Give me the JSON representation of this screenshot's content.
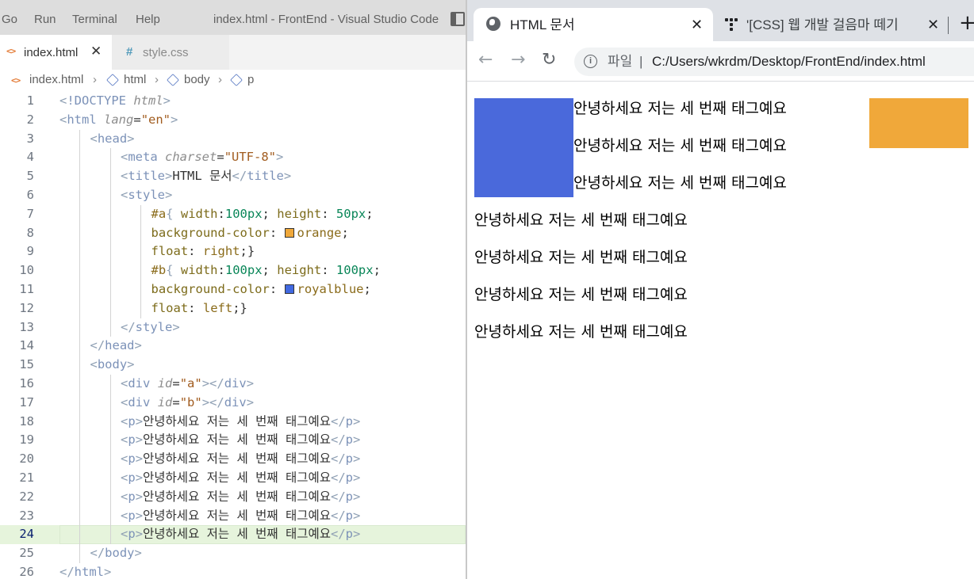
{
  "vscode": {
    "menu": [
      "Go",
      "Run",
      "Terminal",
      "Help"
    ],
    "window_title": "index.html - FrontEnd - Visual Studio Code",
    "tabs": [
      {
        "label": "index.html",
        "active": true,
        "icon": "html-icon"
      },
      {
        "label": "style.css",
        "active": false,
        "icon": "css-hash-icon"
      }
    ],
    "breadcrumb": [
      "index.html",
      "html",
      "body",
      "p"
    ],
    "active_line": 24,
    "colors": {
      "orange": "#f0a83a",
      "royalblue": "#4169e1"
    },
    "lines": [
      "<!DOCTYPE html>",
      "<html lang=\"en\">",
      "<head>",
      "<meta charset=\"UTF-8\">",
      "<title>HTML 문서</title>",
      "<style>",
      "#a{ width:100px; height: 50px;",
      "background-color: orange;",
      "float: right;}",
      "#b{ width:100px; height: 100px;",
      "background-color: royalblue;",
      "float: left;}",
      "</style>",
      "</head>",
      "<body>",
      "<div id=\"a\"></div>",
      "<div id=\"b\"></div>",
      "<p>안녕하세요 저는 세 번째 태그예요</p>",
      "<p>안녕하세요 저는 세 번째 태그예요</p>",
      "<p>안녕하세요 저는 세 번째 태그예요</p>",
      "<p>안녕하세요 저는 세 번째 태그예요</p>",
      "<p>안녕하세요 저는 세 번째 태그예요</p>",
      "<p>안녕하세요 저는 세 번째 태그예요</p>",
      "<p>안녕하세요 저는 세 번째 태그예요</p>",
      "</body>",
      "</html>"
    ]
  },
  "browser": {
    "tabs": [
      {
        "title": "HTML 문서",
        "icon": "globe-icon"
      },
      {
        "title": "'[CSS] 웹 개발 걸음마 떼기",
        "icon": "tree-icon"
      }
    ],
    "new_tab_glyph": "+",
    "address": {
      "scheme_label": "파일",
      "separator": "|",
      "url": "C:/Users/wkrdm/Desktop/FrontEnd/index.html"
    },
    "paragraphs": [
      "안녕하세요 저는 세 번째 태그예요",
      "안녕하세요 저는 세 번째 태그예요",
      "안녕하세요 저는 세 번째 태그예요",
      "안녕하세요 저는 세 번째 태그예요",
      "안녕하세요 저는 세 번째 태그예요",
      "안녕하세요 저는 세 번째 태그예요",
      "안녕하세요 저는 세 번째 태그예요"
    ],
    "box_colors": {
      "a": "#f0a83a",
      "b": "#4a69db"
    }
  }
}
